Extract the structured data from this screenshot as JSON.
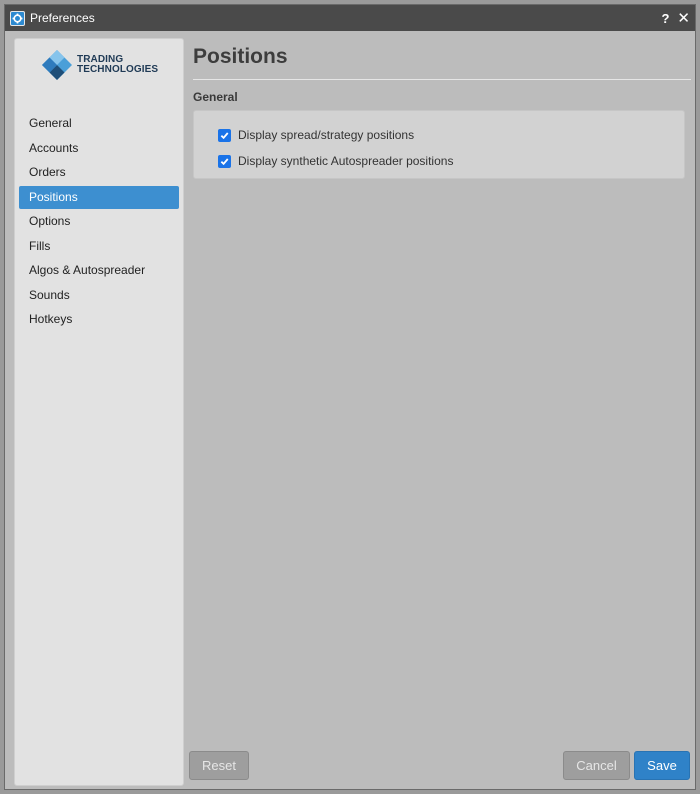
{
  "window": {
    "title": "Preferences"
  },
  "title_actions": {
    "help_label": "?",
    "close_label": "✕"
  },
  "logo": {
    "line1": "TRADING",
    "line2": "TECHNOLOGIES"
  },
  "sidebar": {
    "items": [
      {
        "label": "General",
        "active": false
      },
      {
        "label": "Accounts",
        "active": false
      },
      {
        "label": "Orders",
        "active": false
      },
      {
        "label": "Positions",
        "active": true
      },
      {
        "label": "Options",
        "active": false
      },
      {
        "label": "Fills",
        "active": false
      },
      {
        "label": "Algos & Autospreader",
        "active": false
      },
      {
        "label": "Sounds",
        "active": false
      },
      {
        "label": "Hotkeys",
        "active": false
      }
    ]
  },
  "main": {
    "title": "Positions",
    "section": {
      "label": "General",
      "options": [
        {
          "label": "Display spread/strategy positions",
          "checked": true
        },
        {
          "label": "Display synthetic Autospreader positions",
          "checked": true
        }
      ]
    }
  },
  "buttons": {
    "reset": "Reset",
    "cancel": "Cancel",
    "save": "Save"
  },
  "colors": {
    "accent": "#3d8fd0",
    "save": "#2f82c8",
    "checkbox": "#1a73e8",
    "titlebar": "#4a4a4a"
  }
}
